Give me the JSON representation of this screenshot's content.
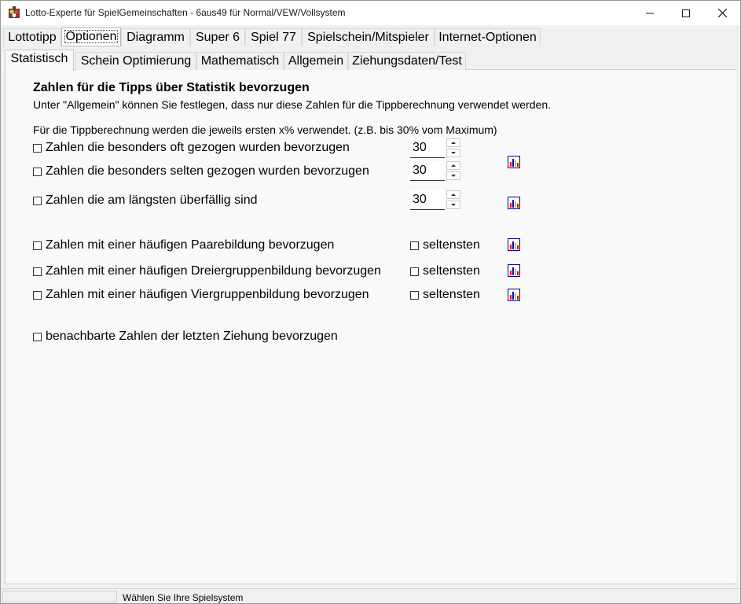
{
  "window": {
    "title": "Lotto-Experte für SpielGemeinschaften - 6aus49 für Normal/VEW/Vollsystem",
    "icons": {
      "app": "lotto-app-icon",
      "minimize": "minimize-icon",
      "maximize": "maximize-icon",
      "close": "close-icon"
    }
  },
  "main_tabs": [
    "Lottotipp",
    "Optionen",
    "Diagramm",
    "Super 6",
    "Spiel 77",
    "Spielschein/Mitspieler",
    "Internet-Optionen"
  ],
  "main_tab_active": "Optionen",
  "sub_tabs": [
    "Statistisch",
    "Schein Optimierung",
    "Mathematisch",
    "Allgemein",
    "Ziehungsdaten/Test"
  ],
  "sub_tab_active": "Statistisch",
  "panel": {
    "heading": "Zahlen für die Tipps über Statistik bevorzugen",
    "subtext": "Unter \"Allgemein\" können Sie festlegen, dass nur diese Zahlen für die Tippberechnung verwendet werden.",
    "info": "Für die Tippberechnung werden die jeweils ersten x% verwendet. (z.B. bis 30% vom Maximum)",
    "options": [
      {
        "label": "Zahlen die besonders oft gezogen wurden bevorzugen",
        "checked": false,
        "value": "30"
      },
      {
        "label": "Zahlen die besonders selten gezogen wurden bevorzugen",
        "checked": false,
        "value": "30"
      },
      {
        "label": "Zahlen die am längsten überfällig sind",
        "checked": false,
        "value": "30"
      }
    ],
    "group_options": [
      {
        "label": "Zahlen mit einer häufigen Paarebildung bevorzugen",
        "checked": false,
        "secondary_label": "seltensten",
        "secondary_checked": false
      },
      {
        "label": "Zahlen mit einer häufigen Dreiergruppenbildung bevorzugen",
        "checked": false,
        "secondary_label": "seltensten",
        "secondary_checked": false
      },
      {
        "label": "Zahlen mit einer häufigen Viergruppenbildung bevorzugen",
        "checked": false,
        "secondary_label": "seltensten",
        "secondary_checked": false
      }
    ],
    "neighbor_option": {
      "label": "benachbarte Zahlen der letzten Ziehung bevorzugen",
      "checked": false
    },
    "chart_icon": "bar-chart-icon"
  },
  "statusbar": {
    "text": "Wählen Sie Ihre Spielsystem"
  }
}
